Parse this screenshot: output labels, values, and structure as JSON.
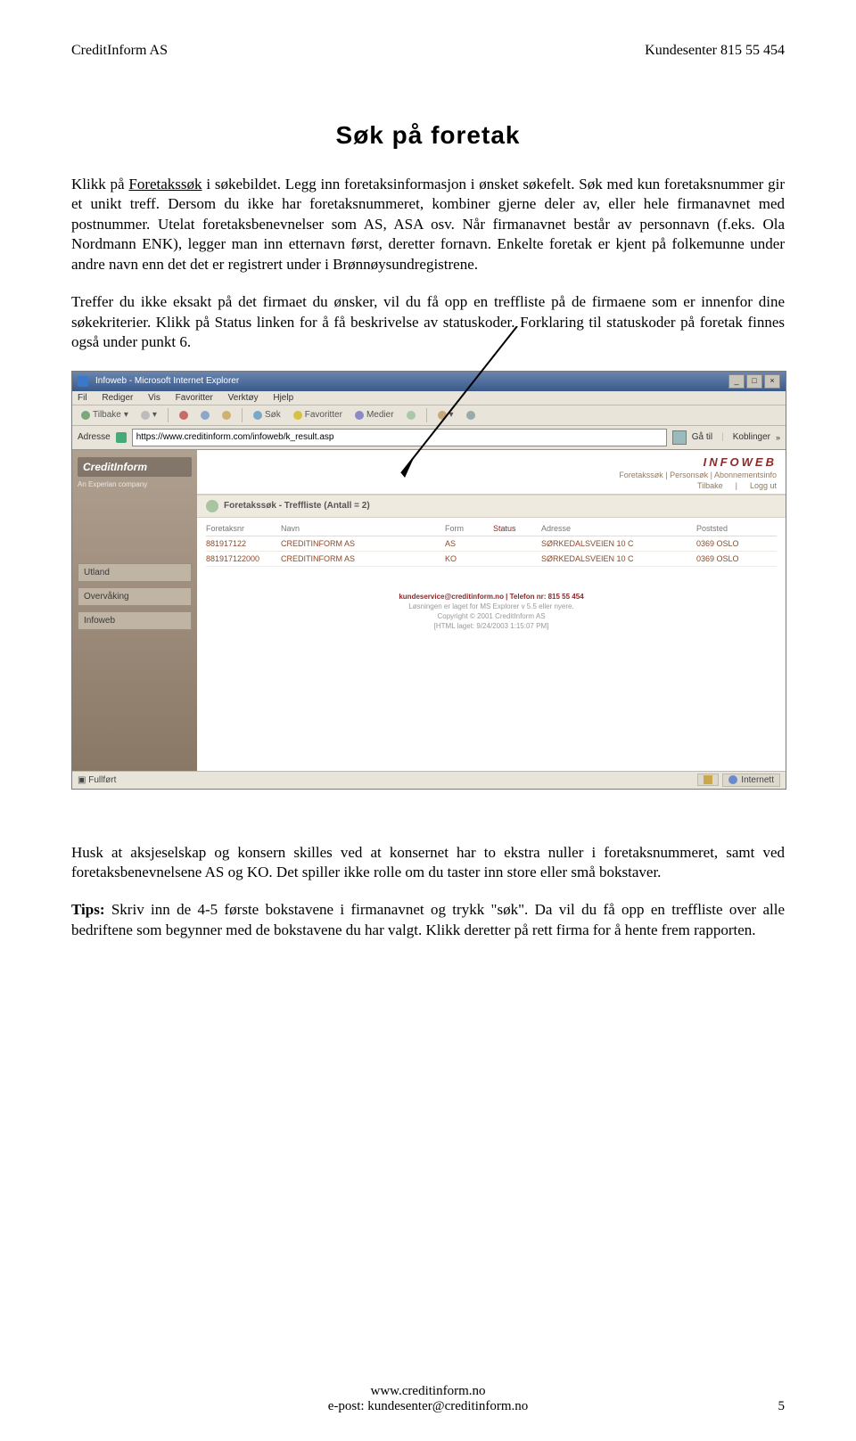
{
  "header": {
    "left": "CreditInform AS",
    "right": "Kundesenter 815 55 454"
  },
  "title": "Søk på foretak",
  "paragraphs": {
    "p1a": "Klikk på ",
    "p1link": "Foretakssøk",
    "p1b": " i søkebildet. Legg inn foretaksinformasjon i ønsket søkefelt. Søk med kun foretaksnummer gir et unikt treff. Dersom du ikke har foretaksnummeret, kombiner gjerne deler av, eller hele firmanavnet med postnummer. Utelat foretaksbenevnelser som AS, ASA osv. Når firmanavnet består av personnavn (f.eks. Ola Nordmann ENK), legger man inn etternavn først, deretter fornavn. Enkelte foretak er kjent på folkemunne under andre navn enn det det er registrert under i Brønnøysundregistrene.",
    "p2": "Treffer du ikke eksakt på det firmaet du ønsker, vil du få opp en treffliste på de firmaene som er innenfor dine søkekriterier. Klikk på Status linken for å få beskrivelse av statuskoder. Forklaring til statuskoder på foretak finnes også under punkt 6.",
    "p3": "Husk at aksjeselskap og konsern skilles ved at konsernet har to ekstra nuller i foretaksnummeret, samt ved foretaksbenevnelsene AS og KO. Det spiller ikke rolle om du taster inn store eller små bokstaver.",
    "p4a": "Tips:",
    "p4b": " Skriv inn de 4-5 første bokstavene i firmanavnet og trykk \"søk\". Da vil du få opp en treffliste over alle bedriftene som begynner med de bokstavene du har valgt. Klikk deretter på rett firma for å hente frem rapporten."
  },
  "shot": {
    "window_title": "Infoweb - Microsoft Internet Explorer",
    "menu": [
      "Fil",
      "Rediger",
      "Vis",
      "Favoritter",
      "Verktøy",
      "Hjelp"
    ],
    "toolbar": {
      "back": "Tilbake",
      "search": "Søk",
      "favorites": "Favoritter",
      "media": "Medier"
    },
    "address": {
      "label": "Adresse",
      "url": "https://www.creditinform.com/infoweb/k_result.asp",
      "go": "Gå til",
      "links": "Koblinger"
    },
    "brand": {
      "logo": "CreditInform",
      "tagline": "An Experian company",
      "product": "INFOWEB"
    },
    "toplinks": "Foretakssøk | Personsøk | Abonnementsinfo",
    "toptabs": [
      "Tilbake",
      "|",
      "Logg ut"
    ],
    "sidebar": {
      "btn1": "Utland",
      "btn2": "Overvåking",
      "btn3": "Infoweb"
    },
    "result_header": "Foretakssøk - Treffliste (Antall = 2)",
    "columns": {
      "c1": "Foretaksnr",
      "c2": "Navn",
      "c3": "Form",
      "c4": "Status",
      "c5": "Adresse",
      "c6": "Poststed"
    },
    "rows": [
      {
        "nr": "881917122",
        "navn": "CREDITINFORM AS",
        "form": "AS",
        "status": "",
        "adresse": "SØRKEDALSVEIEN 10 C",
        "post": "0369 OSLO"
      },
      {
        "nr": "881917122000",
        "navn": "CREDITINFORM AS",
        "form": "KO",
        "status": "",
        "adresse": "SØRKEDALSVEIEN 10 C",
        "post": "0369 OSLO"
      }
    ],
    "footerinfo": {
      "kund": "kundeservice@creditinform.no | Telefon nr: 815 55 454",
      "line2": "Løsningen er laget for MS Explorer v 5.5 eller nyere.",
      "line3": "Copyright © 2001 CreditInform AS",
      "line4": "[HTML laget: 9/24/2003 1:15:07 PM]"
    },
    "statusbar": {
      "left": "Fullført",
      "right": "Internett"
    }
  },
  "footer": {
    "line1": "www.creditinform.no",
    "line2": "e-post: kundesenter@creditinform.no",
    "pagenum": "5"
  }
}
